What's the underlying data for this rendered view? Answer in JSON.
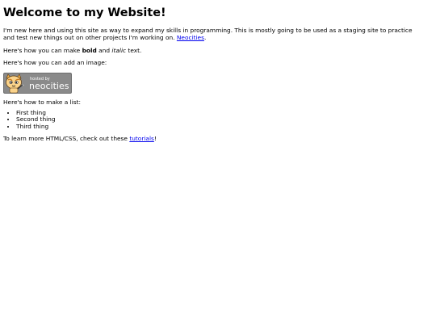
{
  "page": {
    "title": "Welcome to my Website!",
    "intro_text": "I'm new here and using this site as way to expand my skills in programming. This is mostly going to be used as a staging site to practice and test new things out on other projects I'm working on.",
    "intro_link": "Neocities",
    "intro_end": ".",
    "bold_prefix": "Here's how you can make",
    "bold_word": "bold",
    "bold_and": "and",
    "italic_word": "italic",
    "bold_suffix": "text.",
    "image_text": "Here's how you can add an image:",
    "badge": {
      "hosted_by": "hosted by",
      "brand": "neocities"
    },
    "list_text": "Here's how to make a list:",
    "list_items": [
      "First thing",
      "Second thing",
      "Third thing"
    ],
    "learn_prefix": "To learn more HTML/CSS, check out these",
    "learn_link": "tutorials",
    "learn_suffix": "!"
  },
  "colors": {
    "link": "#0000ee",
    "badge_bg": "#8a8a8a",
    "badge_text": "#ffffff"
  }
}
